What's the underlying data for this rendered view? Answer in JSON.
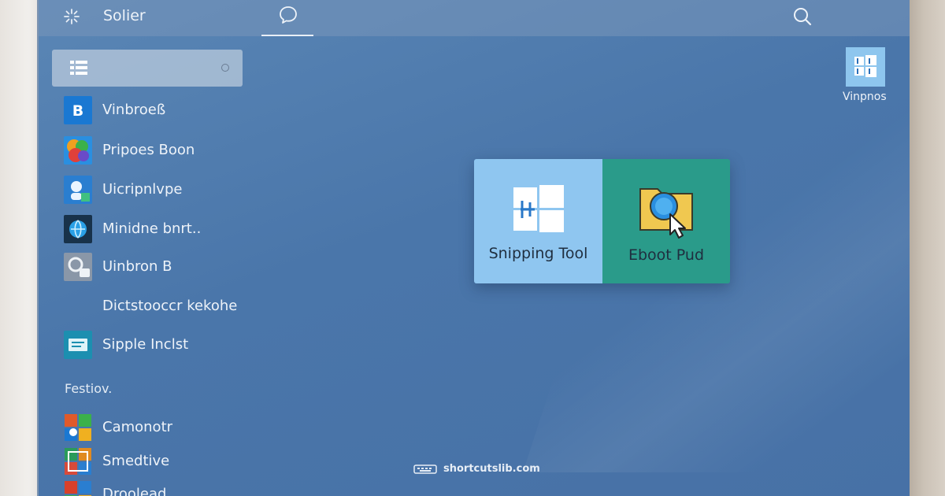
{
  "topbar": {
    "title": "Solier",
    "logo_icon": "sparkle-logo-icon",
    "chat_icon": "chat-bubble-icon",
    "search_icon": "search-icon"
  },
  "start_menu": {
    "search_icon": "list-icon",
    "items": [
      {
        "label": "Vinbroeß",
        "icon": "blue-b-app-icon"
      },
      {
        "label": "Pripoes Boon",
        "icon": "colorful-app-icon"
      },
      {
        "label": "Uicripnlvpe",
        "icon": "blue-person-app-icon"
      },
      {
        "label": "Minidne bnrt..",
        "icon": "dark-globe-app-icon"
      },
      {
        "label": "Uinbron B",
        "icon": "gray-gear-app-icon"
      },
      {
        "label": "Dictstooccr kekohe",
        "icon": ""
      },
      {
        "label": "Sipple Inclst",
        "icon": "teal-note-app-icon"
      }
    ],
    "section_label": "Festiov.",
    "section_items": [
      {
        "label": "Camonotr",
        "icon": "multicolor-grid-icon"
      },
      {
        "label": "Smedtive",
        "icon": "multicolor-grid-icon"
      },
      {
        "label": "Droolead",
        "icon": "multicolor-grid-icon"
      }
    ]
  },
  "desktop_icon": {
    "label": "Vinpnos",
    "icon": "windows-logo-icon"
  },
  "popup": {
    "tile_a": {
      "label": "Snipping Tool",
      "icon": "windows-logo-icon"
    },
    "tile_b": {
      "label": "Eboot Pud",
      "icon": "folder-magnifier-icon"
    }
  },
  "watermark": {
    "text": "shortcutslib.com",
    "icon": "keyboard-icon"
  },
  "colors": {
    "accent_blue": "#8fc6f0",
    "accent_teal": "#2a9b8a",
    "screen_bg": "#4a76aa"
  }
}
